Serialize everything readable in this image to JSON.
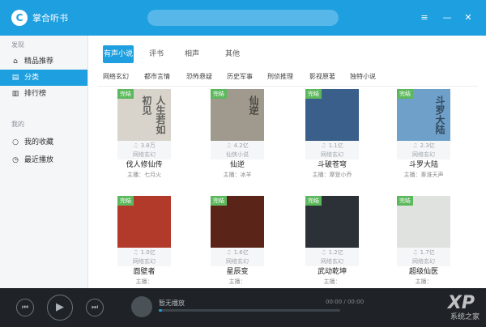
{
  "app": {
    "title": "掌合听书",
    "logo": "C"
  },
  "search": {
    "placeholder": ""
  },
  "window_controls": [
    "≡",
    "—",
    "✕"
  ],
  "sidebar": {
    "section_1": "发现",
    "items": [
      {
        "icon": "⌂",
        "label": "精品推荐"
      },
      {
        "icon": "▤",
        "label": "分类"
      },
      {
        "icon": "▥",
        "label": "排行榜"
      }
    ],
    "section_2": "我的",
    "my_items": [
      {
        "icon": "○",
        "label": "我的收藏"
      },
      {
        "icon": "◷",
        "label": "最近播放"
      }
    ]
  },
  "tabs": [
    "有声小说",
    "评书",
    "相声",
    "其他"
  ],
  "subcategories": [
    "网络玄幻",
    "都市言情",
    "恐怖悬疑",
    "历史军事",
    "刑侦推理",
    "影视原著",
    "独特小说"
  ],
  "books": [
    {
      "badge": "完结",
      "cover_text": "人生若如初见",
      "cover_color": "#d8d4cc",
      "plays": "3.8万",
      "genre": "网络玄幻",
      "name": "伐人修仙传",
      "host": "主播：七月火"
    },
    {
      "badge": "完结",
      "cover_text": "仙逆",
      "cover_color": "#a09a8e",
      "plays": "4.2亿",
      "genre": "仙侠小说",
      "name": "仙逆",
      "host": "主播：冰羊"
    },
    {
      "badge": "完结",
      "cover_text": "",
      "cover_color": "#3a5f8a",
      "plays": "1.1亿",
      "genre": "网络玄幻",
      "name": "斗破苍穹",
      "host": "主播：摩登小乔"
    },
    {
      "badge": "完结",
      "cover_text": "斗罗大陆",
      "cover_color": "#6fa0c9",
      "plays": "2.3亿",
      "genre": "网络玄幻",
      "name": "斗罗大陆",
      "host": "主播：秦淮天声"
    },
    {
      "badge": "完结",
      "cover_text": "",
      "cover_color": "#b23a2a",
      "plays": "1.0亿",
      "genre": "网络玄幻",
      "name": "面壁者",
      "host": "主播："
    },
    {
      "badge": "完结",
      "cover_text": "",
      "cover_color": "#5a2418",
      "plays": "1.6亿",
      "genre": "网络玄幻",
      "name": "星辰变",
      "host": "主播："
    },
    {
      "badge": "完结",
      "cover_text": "",
      "cover_color": "#2c3137",
      "plays": "1.2亿",
      "genre": "网络玄幻",
      "name": "武动乾坤",
      "host": "主播："
    },
    {
      "badge": "完结",
      "cover_text": "",
      "cover_color": "#dfe2de",
      "plays": "1.7亿",
      "genre": "网络玄幻",
      "name": "超级仙医",
      "host": "主播："
    }
  ],
  "player": {
    "now_title": "暂无播放",
    "time": "00:00 / 00:00",
    "progress": 0.02
  },
  "watermark": {
    "main": "XP",
    "sub": "系统之家"
  }
}
